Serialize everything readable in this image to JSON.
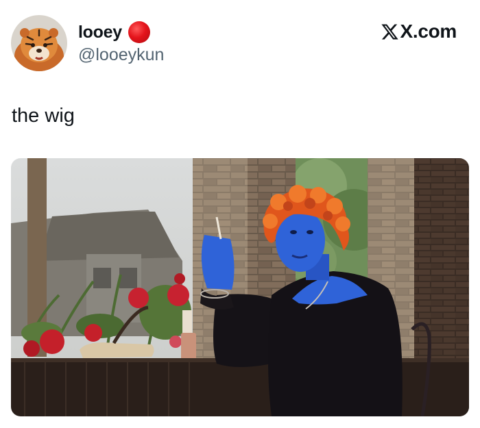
{
  "author": {
    "display_name": "looey",
    "handle": "@looeykun",
    "avatar_icon": "tiger-avatar-icon",
    "badge_icon": "red-circle-emoji-icon",
    "badge_color": "#e4141b"
  },
  "brand": {
    "label": "X.com",
    "icon": "x-logo-icon"
  },
  "tweet": {
    "text": "the wig"
  },
  "media": {
    "type": "photo",
    "accent_colors": {
      "skin": "#2f63d8",
      "wig": "#e0561c",
      "brick": "#8a7560",
      "roses": "#c4202a"
    }
  }
}
